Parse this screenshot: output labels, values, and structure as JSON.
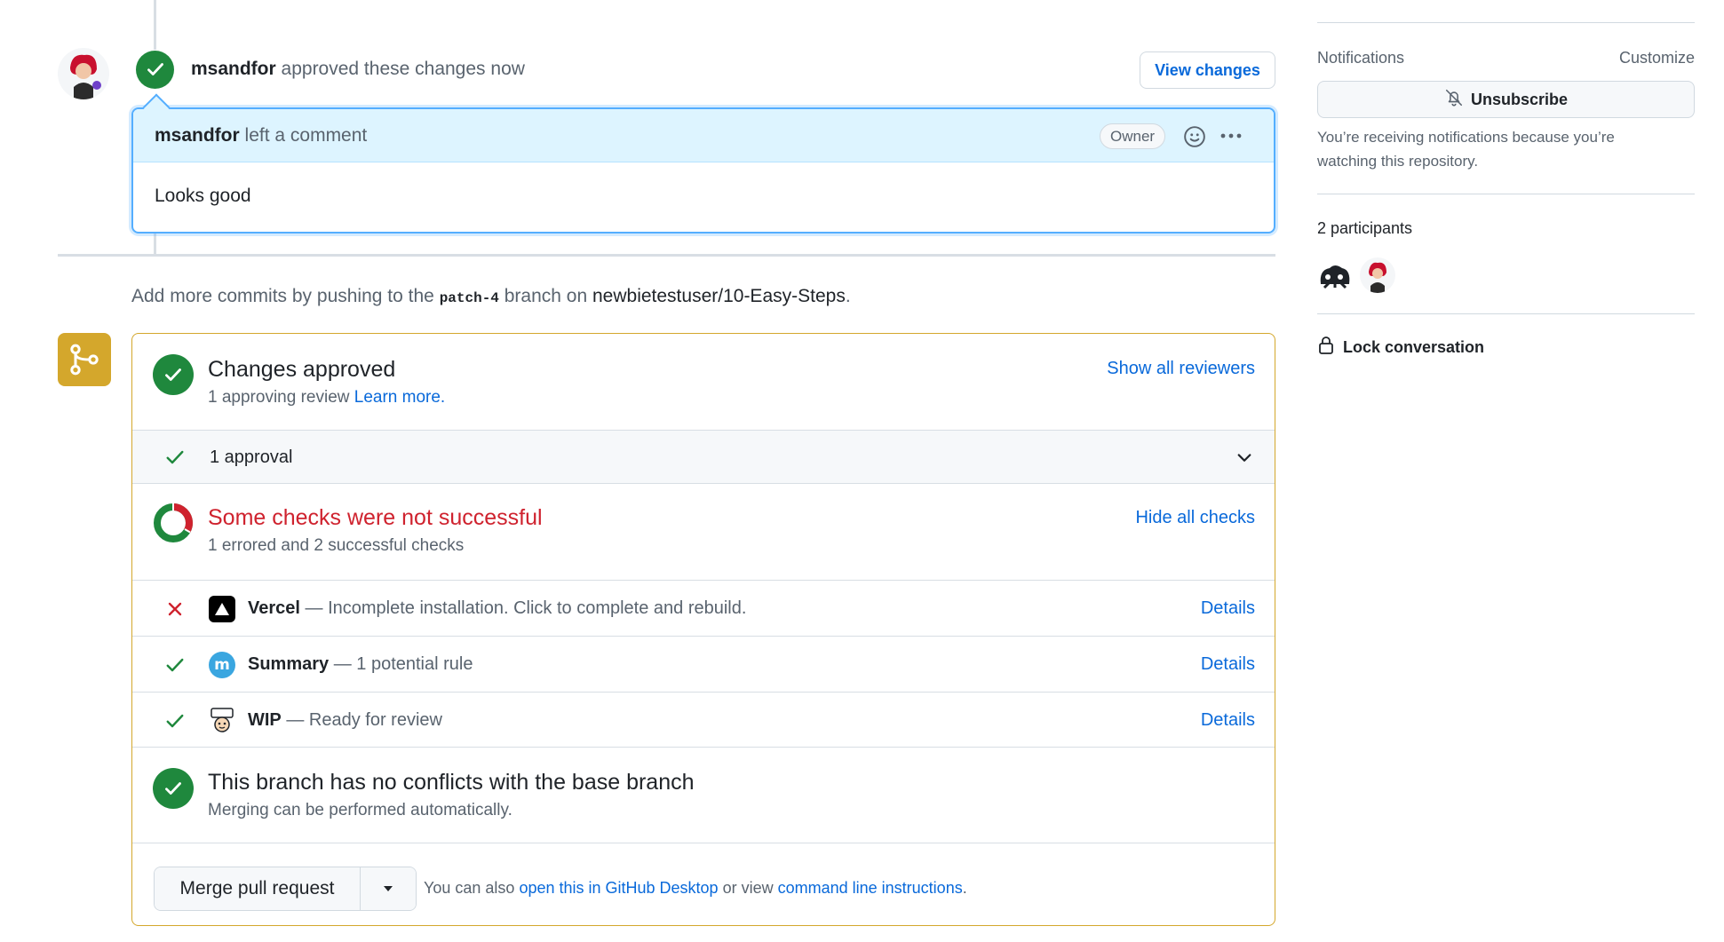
{
  "review": {
    "reviewer": "msandfor",
    "action": "approved these changes",
    "time": "now",
    "view_changes_label": "View changes"
  },
  "comment": {
    "author": "msandfor",
    "action": "left a comment",
    "badge": "Owner",
    "body": "Looks good"
  },
  "push_hint": {
    "prefix": "Add more commits by pushing to the",
    "branch": "patch-4",
    "middle": "branch on",
    "repo": "newbietestuser/10-Easy-Steps",
    "suffix": "."
  },
  "merge": {
    "approved": {
      "title": "Changes approved",
      "sub_text": "1 approving review",
      "learn_more": "Learn more.",
      "link": "Show all reviewers"
    },
    "approval_row": {
      "label": "1 approval"
    },
    "checks": {
      "title": "Some checks were not successful",
      "sub_text": "1 errored and 2 successful checks",
      "link": "Hide all checks",
      "items": [
        {
          "status": "error",
          "name": "Vercel",
          "desc": "— Incomplete installation. Click to complete and rebuild.",
          "details": "Details",
          "logo": "vercel-logo"
        },
        {
          "status": "success",
          "name": "Summary",
          "desc": "— 1 potential rule",
          "details": "Details",
          "logo": "mergeable-logo"
        },
        {
          "status": "success",
          "name": "WIP",
          "desc": "— Ready for review",
          "details": "Details",
          "logo": "wip-logo"
        }
      ]
    },
    "conflicts": {
      "title": "This branch has no conflicts with the base branch",
      "sub_text": "Merging can be performed automatically."
    },
    "merge_button": "Merge pull request",
    "note": {
      "prefix": "You can also",
      "desktop_link": "open this in GitHub Desktop",
      "middle": "or view",
      "cli_link": "command line instructions",
      "suffix": "."
    }
  },
  "sidebar": {
    "notifications_heading": "Notifications",
    "customize": "Customize",
    "unsubscribe": "Unsubscribe",
    "notif_text": "You’re receiving notifications because you’re watching this repository.",
    "participants_heading": "2 participants",
    "lock": "Lock conversation"
  },
  "colors": {
    "success": "#1f883d",
    "danger": "#cf222e",
    "link": "#0969da",
    "merge_border": "#d4a72c",
    "comment_header": "#ddf4ff"
  }
}
